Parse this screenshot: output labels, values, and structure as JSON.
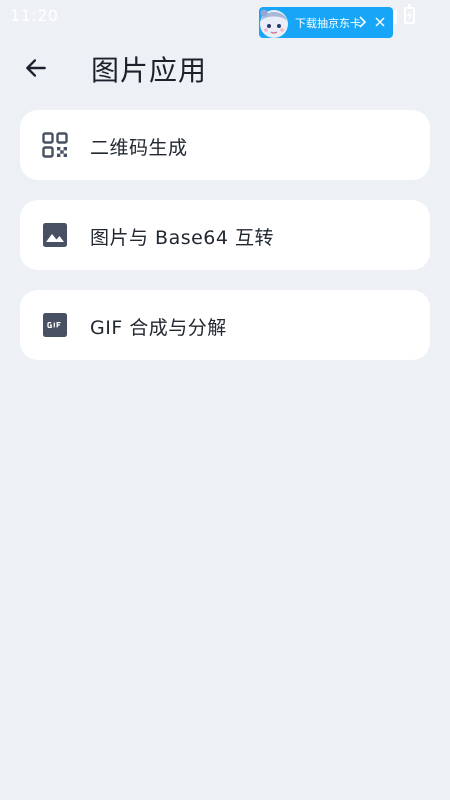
{
  "status_bar": {
    "time": "11:20"
  },
  "promo": {
    "text": "下载抽京东卡",
    "icons": [
      "mascot-avatar",
      "chevron-right-icon",
      "close-icon"
    ]
  },
  "header": {
    "title": "图片应用",
    "back_icon": "arrow-left-icon"
  },
  "menu": {
    "items": [
      {
        "label": "二维码生成",
        "icon": "qr-code-icon"
      },
      {
        "label": "图片与 Base64 互转",
        "icon": "image-icon"
      },
      {
        "label": "GIF 合成与分解",
        "icon": "gif-icon"
      }
    ]
  },
  "colors": {
    "background": "#edf1f6",
    "card": "#ffffff",
    "icon": "#475163",
    "promo": "#17a6f7",
    "text": "#222831"
  }
}
